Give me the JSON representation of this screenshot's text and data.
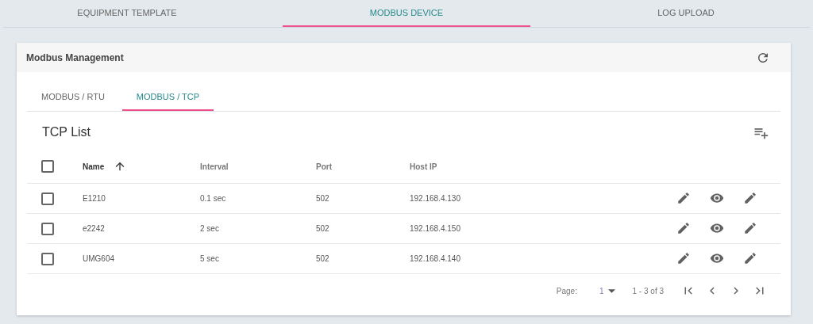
{
  "top_tabs": [
    {
      "label": "EQUIPMENT TEMPLATE",
      "selected": false
    },
    {
      "label": "MODBUS DEVICE",
      "selected": true
    },
    {
      "label": "LOG UPLOAD",
      "selected": false
    }
  ],
  "card": {
    "title": "Modbus Management",
    "sub_tabs": [
      {
        "label": "MODBUS / RTU",
        "selected": false
      },
      {
        "label": "MODBUS / TCP",
        "selected": true
      }
    ],
    "list_title": "TCP List",
    "table": {
      "select_all": {
        "checked": false
      },
      "columns": [
        {
          "label": "Name",
          "sorted": true
        },
        {
          "label": "Interval",
          "sorted": false
        },
        {
          "label": "Port",
          "sorted": false
        },
        {
          "label": "Host IP",
          "sorted": false
        }
      ],
      "rows": [
        {
          "checked": false,
          "cells": [
            "E1210",
            "0.1 sec",
            "502",
            "192.168.4.130"
          ]
        },
        {
          "checked": false,
          "cells": [
            "e2242",
            "2 sec",
            "502",
            "192.168.4.150"
          ]
        },
        {
          "checked": false,
          "cells": [
            "UMG604",
            "5 sec",
            "502",
            "192.168.4.140"
          ]
        }
      ]
    },
    "pagination": {
      "page_label": "Page:",
      "page": "1",
      "range": "1 - 3 of 3"
    }
  }
}
